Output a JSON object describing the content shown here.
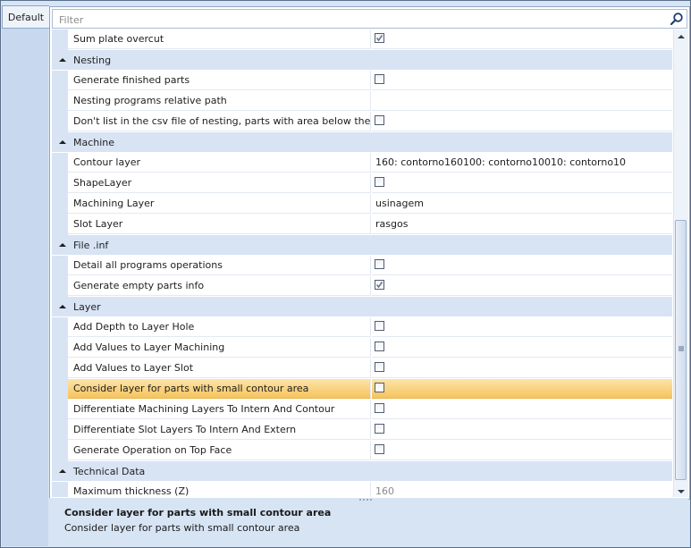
{
  "tabs": [
    {
      "label": "Default"
    }
  ],
  "filter": {
    "placeholder": "Filter",
    "value": ""
  },
  "categories": {
    "top": {
      "rows": [
        {
          "label": "Sum plate overcut",
          "checked": true
        }
      ]
    },
    "nesting": {
      "label": "Nesting",
      "rows": [
        {
          "label": "Generate finished parts",
          "checked": false
        },
        {
          "label": "Nesting programs relative path",
          "value": ""
        },
        {
          "label": "Don't list in the csv file of nesting, parts with area below the repo...",
          "checked": false
        }
      ]
    },
    "machine": {
      "label": "Machine",
      "rows": [
        {
          "label": "Contour layer",
          "value": "160: contorno160100: contorno10010: contorno10"
        },
        {
          "label": "ShapeLayer",
          "checked": false
        },
        {
          "label": "Machining Layer",
          "value": "usinagem"
        },
        {
          "label": "Slot Layer",
          "value": "rasgos"
        }
      ]
    },
    "fileinf": {
      "label": "File .inf",
      "rows": [
        {
          "label": "Detail all programs operations",
          "checked": false
        },
        {
          "label": "Generate empty parts info",
          "checked": true
        }
      ]
    },
    "layer": {
      "label": "Layer",
      "rows": [
        {
          "label": "Add Depth to Layer Hole",
          "checked": false
        },
        {
          "label": "Add Values to Layer Machining",
          "checked": false
        },
        {
          "label": "Add Values to Layer Slot",
          "checked": false
        },
        {
          "label": "Consider layer for parts with small contour area",
          "checked": false,
          "selected": true
        },
        {
          "label": "Differentiate Machining Layers To Intern And Contour",
          "checked": false
        },
        {
          "label": "Differentiate Slot Layers To Intern And Extern",
          "checked": false
        },
        {
          "label": "Generate Operation on Top Face",
          "checked": false
        }
      ]
    },
    "technical": {
      "label": "Technical Data",
      "rows": [
        {
          "label": "Maximum thickness (Z)",
          "value": "160"
        }
      ]
    }
  },
  "help": {
    "title": "Consider layer for parts with small contour area",
    "description": "Consider layer for parts with small contour area"
  },
  "colors": {
    "category_bg": "#d8e4f4",
    "selection": "#f6c45e",
    "panel_bg": "#d7e4f4"
  },
  "icons": {
    "search": "search-icon",
    "collapse": "chevron-up-icon",
    "check": "check-icon"
  }
}
